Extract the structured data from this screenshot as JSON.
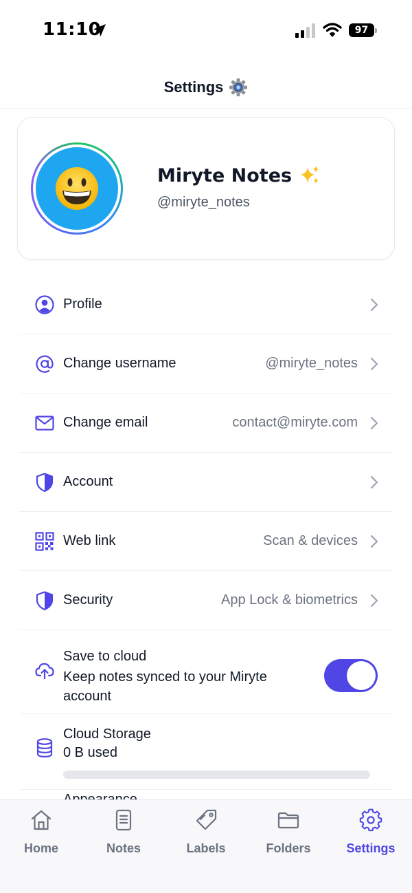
{
  "status_bar": {
    "time": "11:10",
    "battery": "97"
  },
  "header": {
    "title": "Settings"
  },
  "profile": {
    "name": "Miryte Notes",
    "handle": "@miryte_notes",
    "avatar_icon": "grinning-face-emoji",
    "sparkle_icon": "sparkles-emoji"
  },
  "menu": {
    "profile": {
      "label": "Profile",
      "value": ""
    },
    "username": {
      "label": "Change username",
      "value": "@miryte_notes"
    },
    "email": {
      "label": "Change email",
      "value": "contact@miryte.com"
    },
    "account": {
      "label": "Account",
      "value": ""
    },
    "weblink": {
      "label": "Web link",
      "value": "Scan & devices"
    },
    "security": {
      "label": "Security",
      "value": "App Lock & biometrics"
    }
  },
  "cloud": {
    "title": "Save to cloud",
    "subtitle": "Keep notes synced to your Miryte account",
    "enabled": true
  },
  "storage": {
    "title": "Cloud Storage",
    "used": "0 B used",
    "fraction": 0
  },
  "appearance_peek": "Appearance",
  "tabs": [
    {
      "label": "Home",
      "icon": "home-icon",
      "active": false
    },
    {
      "label": "Notes",
      "icon": "notes-icon",
      "active": false
    },
    {
      "label": "Labels",
      "icon": "tag-icon",
      "active": false
    },
    {
      "label": "Folders",
      "icon": "folder-icon",
      "active": false
    },
    {
      "label": "Settings",
      "icon": "gear-icon",
      "active": true
    }
  ],
  "colors": {
    "accent": "#4f46e5",
    "avatar_bg": "#1ea7f0",
    "muted_text": "#6b7280"
  }
}
